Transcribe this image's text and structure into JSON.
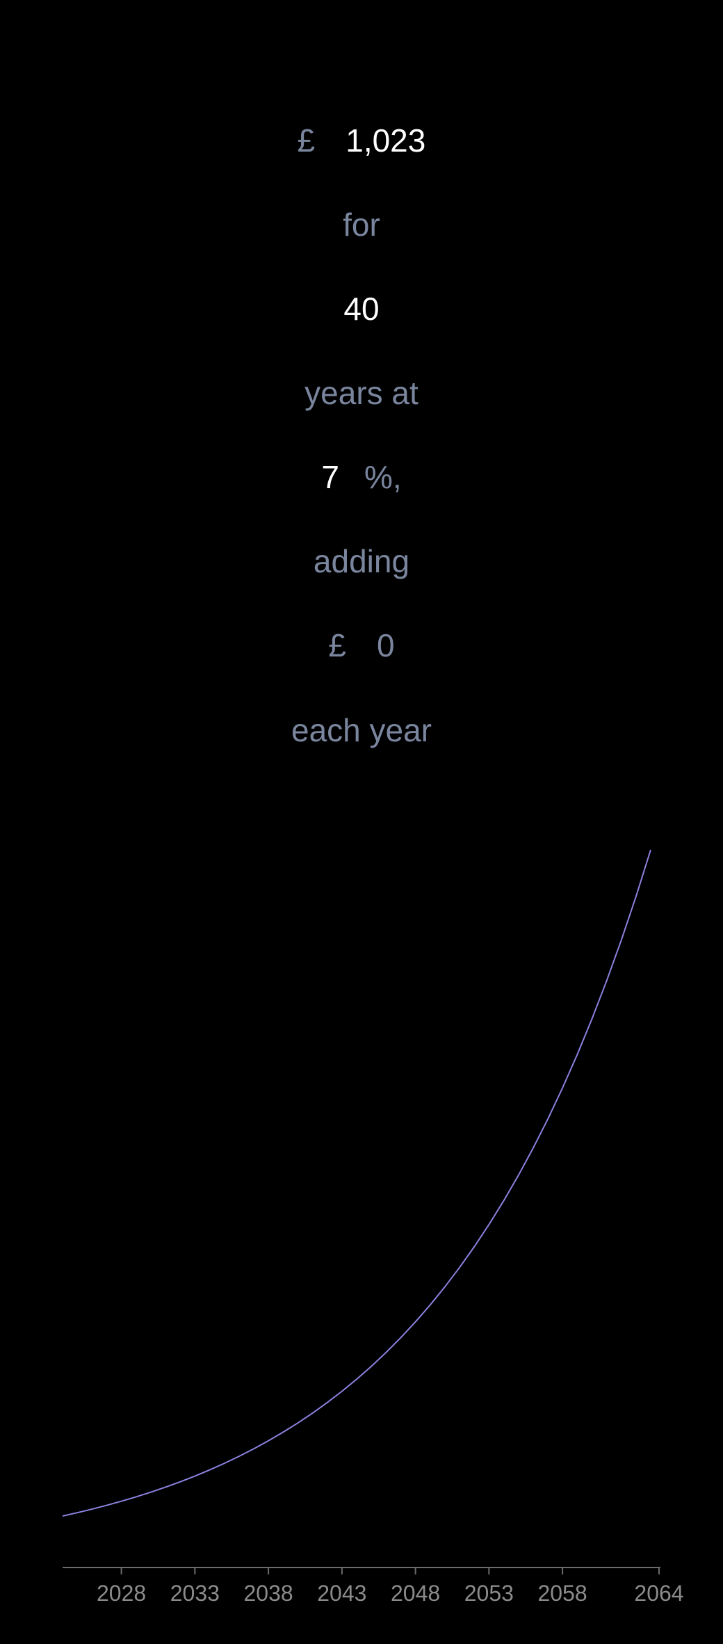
{
  "form": {
    "principal": {
      "currency": "£",
      "value": "1,023"
    },
    "for_label": "for",
    "years": {
      "value": "40"
    },
    "years_at_label": "years at",
    "rate": {
      "value": "7",
      "suffix": "%,"
    },
    "adding_label": "adding",
    "contribution": {
      "currency": "£",
      "value": "0"
    },
    "each_year_label": "each year"
  },
  "chart_data": {
    "type": "line",
    "x_tick_labels": [
      "2028",
      "2033",
      "2038",
      "2043",
      "2048",
      "2053",
      "2058",
      "2064"
    ],
    "x_ticks": [
      2028,
      2033,
      2038,
      2043,
      2048,
      2053,
      2058,
      2064
    ],
    "xlim": [
      2024,
      2064
    ],
    "series": [
      {
        "color": "#8b82e0",
        "x": [
          2024,
          2064
        ],
        "start_value": 1023,
        "annual_rate": 0.07,
        "annual_addition": 0
      }
    ],
    "grid": false,
    "y_axis_visible": false
  }
}
